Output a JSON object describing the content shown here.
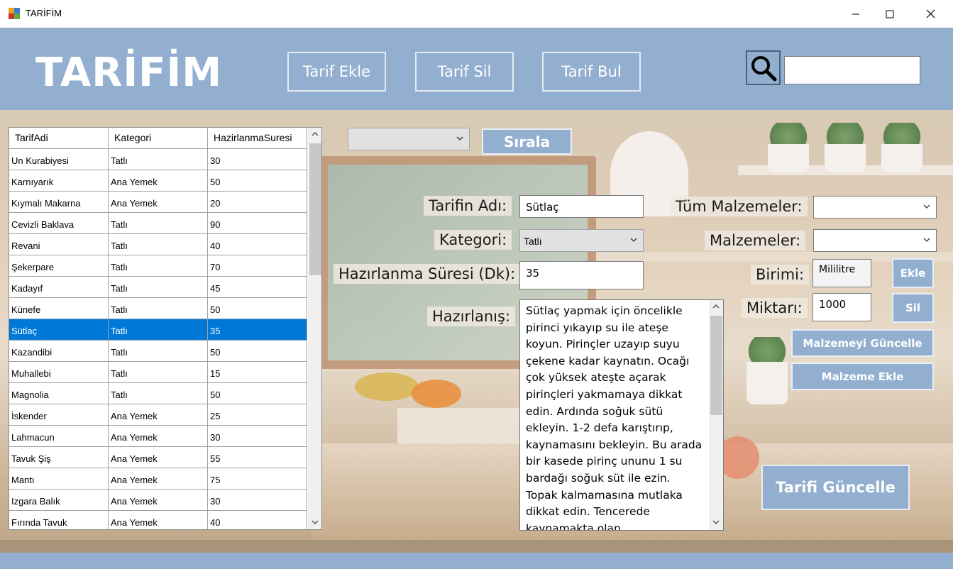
{
  "window": {
    "title": "TARİFİM"
  },
  "header": {
    "brand": "TARİFİM",
    "nav": [
      {
        "label": "Tarif Ekle"
      },
      {
        "label": "Tarif Sil"
      },
      {
        "label": "Tarif Bul"
      }
    ],
    "search_value": ""
  },
  "grid": {
    "columns": [
      "TarifAdi",
      "Kategori",
      "HazirlanmaSuresi"
    ],
    "rows": [
      [
        "Un Kurabiyesi",
        "Tatlı",
        "30"
      ],
      [
        "Karnıyarık",
        "Ana Yemek",
        "50"
      ],
      [
        "Kıymalı Makarna",
        "Ana Yemek",
        "20"
      ],
      [
        "Cevizli Baklava",
        "Tatlı",
        "90"
      ],
      [
        "Revani",
        "Tatlı",
        "40"
      ],
      [
        "Şekerpare",
        "Tatlı",
        "70"
      ],
      [
        "Kadayıf",
        "Tatlı",
        "45"
      ],
      [
        "Künefe",
        "Tatlı",
        "50"
      ],
      [
        "Sütlaç",
        "Tatlı",
        "35"
      ],
      [
        "Kazandibi",
        "Tatlı",
        "50"
      ],
      [
        "Muhallebi",
        "Tatlı",
        "15"
      ],
      [
        "Magnolia",
        "Tatlı",
        "50"
      ],
      [
        "İskender",
        "Ana Yemek",
        "25"
      ],
      [
        "Lahmacun",
        "Ana Yemek",
        "30"
      ],
      [
        "Tavuk Şiş",
        "Ana Yemek",
        "55"
      ],
      [
        "Mantı",
        "Ana Yemek",
        "75"
      ],
      [
        "Izgara Balık",
        "Ana Yemek",
        "30"
      ],
      [
        "Fırında Tavuk",
        "Ana Yemek",
        "40"
      ]
    ],
    "selected_index": 8
  },
  "sort": {
    "selected": "",
    "button_label": "Sırala"
  },
  "form": {
    "name_label": "Tarifin Adı:",
    "name_value": "Sütlaç",
    "category_label": "Kategori:",
    "category_value": "Tatlı",
    "time_label": "Hazırlanma Süresi (Dk):",
    "time_value": "35",
    "prep_label": "Hazırlanış:",
    "prep_text": "Sütlaç yapmak için öncelikle pirinci yıkayıp su ile ateşe koyun. Pirinçler uzayıp suyu çekene kadar kaynatın. Ocağı çok yüksek ateşte açarak pirinçleri yakmamaya dikkat edin. Ardında soğuk sütü ekleyin. 1-2 defa karıştırıp, kaynamasını bekleyin. Bu arada bir kasede pirinç ununu 1 su bardağı soğuk süt ile ezin. Topak kalmamasına mutlaka dikkat edin. Tencerede kaynamakta olan"
  },
  "ingredients": {
    "all_label": "Tüm Malzemeler:",
    "all_value": "",
    "list_label": "Malzemeler:",
    "list_value": "",
    "unit_label": "Birimi:",
    "unit_value": "Mililitre",
    "add_label": "Ekle",
    "amount_label": "Miktarı:",
    "amount_value": "1000",
    "delete_label": "Sil",
    "update_label": "Malzemeyi Güncelle",
    "new_label": "Malzeme Ekle"
  },
  "update_recipe_label": "Tarifi Güncelle",
  "colors": {
    "accent": "#93afd0",
    "selection": "#0078d7"
  }
}
